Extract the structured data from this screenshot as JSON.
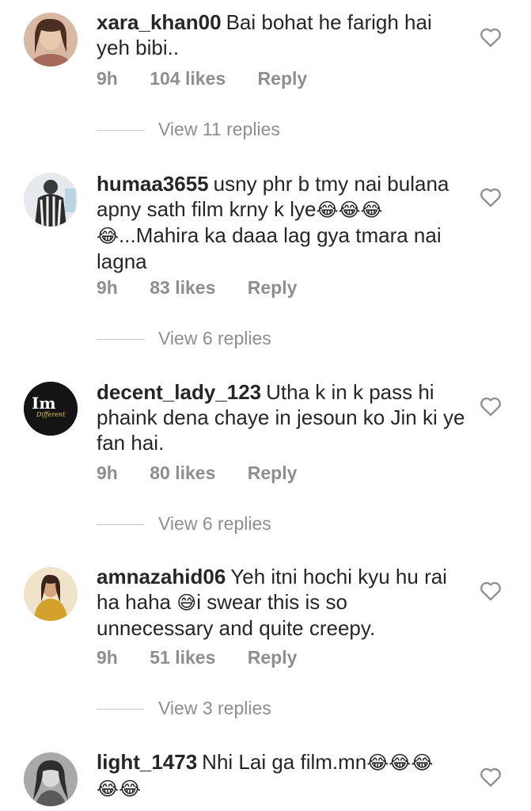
{
  "comments": [
    {
      "username": "xara_khan00",
      "text": "Bai bohat he farigh hai yeh bibi..",
      "time": "9h",
      "likes": "104 likes",
      "reply": "Reply",
      "view_replies": "View 11 replies",
      "avatar_color": "#c9a48a"
    },
    {
      "username": "humaa3655",
      "text_a": "usny phr b tmy nai bulana apny sath film krny k lye",
      "emoji_a": "😂😂😂",
      "emoji_b": "😂",
      "text_b": "...Mahira ka daaa lag gya tmara nai lagna",
      "time": "9h",
      "likes": "83 likes",
      "reply": "Reply",
      "view_replies": "View 6 replies",
      "avatar_color": "#dfe3e8"
    },
    {
      "username": "decent_lady_123",
      "text": "Utha k in k pass hi phaink dena chaye in jesoun ko Jin ki ye fan hai.",
      "time": "9h",
      "likes": "80 likes",
      "reply": "Reply",
      "view_replies": "View 6 replies",
      "avatar_text": "Im",
      "avatar_subtext": "Different",
      "avatar_color": "#141414"
    },
    {
      "username": "amnazahid06",
      "text_a": "Yeh itni hochi kyu hu rai ha haha ",
      "emoji_a": "😅",
      "text_b": "i swear this is so unnecessary and quite creepy.",
      "time": "9h",
      "likes": "51 likes",
      "reply": "Reply",
      "view_replies": "View 3 replies",
      "avatar_color": "#e8d2a8"
    },
    {
      "username": "light_1473",
      "text": "Nhi Lai ga film.mn",
      "emoji_a": "😂😂😂",
      "emoji_b": "😂😂",
      "avatar_color": "#8a8a8a"
    }
  ],
  "colors": {
    "text": "#262626",
    "meta": "#8e8e8e",
    "divider": "#c7c7c7"
  },
  "icons": {
    "like": "heart-outline-icon"
  }
}
